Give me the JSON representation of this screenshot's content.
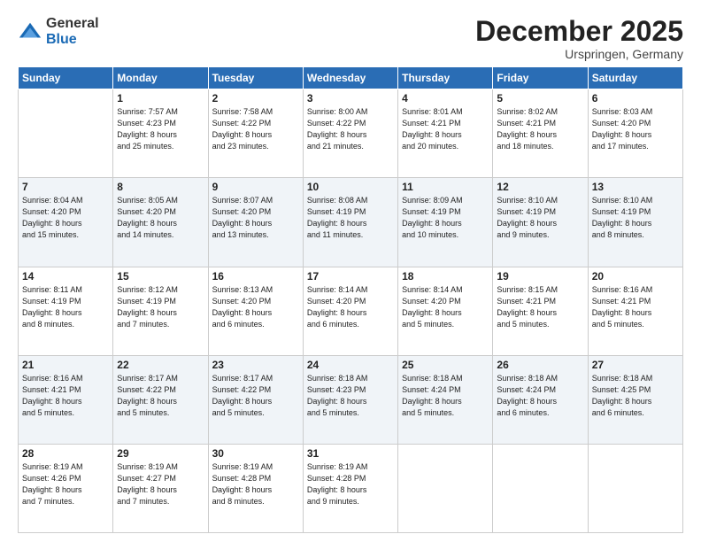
{
  "logo": {
    "general": "General",
    "blue": "Blue"
  },
  "header": {
    "month": "December 2025",
    "location": "Urspringen, Germany"
  },
  "weekdays": [
    "Sunday",
    "Monday",
    "Tuesday",
    "Wednesday",
    "Thursday",
    "Friday",
    "Saturday"
  ],
  "weeks": [
    [
      {
        "num": "",
        "info": ""
      },
      {
        "num": "1",
        "info": "Sunrise: 7:57 AM\nSunset: 4:23 PM\nDaylight: 8 hours\nand 25 minutes."
      },
      {
        "num": "2",
        "info": "Sunrise: 7:58 AM\nSunset: 4:22 PM\nDaylight: 8 hours\nand 23 minutes."
      },
      {
        "num": "3",
        "info": "Sunrise: 8:00 AM\nSunset: 4:22 PM\nDaylight: 8 hours\nand 21 minutes."
      },
      {
        "num": "4",
        "info": "Sunrise: 8:01 AM\nSunset: 4:21 PM\nDaylight: 8 hours\nand 20 minutes."
      },
      {
        "num": "5",
        "info": "Sunrise: 8:02 AM\nSunset: 4:21 PM\nDaylight: 8 hours\nand 18 minutes."
      },
      {
        "num": "6",
        "info": "Sunrise: 8:03 AM\nSunset: 4:20 PM\nDaylight: 8 hours\nand 17 minutes."
      }
    ],
    [
      {
        "num": "7",
        "info": "Sunrise: 8:04 AM\nSunset: 4:20 PM\nDaylight: 8 hours\nand 15 minutes."
      },
      {
        "num": "8",
        "info": "Sunrise: 8:05 AM\nSunset: 4:20 PM\nDaylight: 8 hours\nand 14 minutes."
      },
      {
        "num": "9",
        "info": "Sunrise: 8:07 AM\nSunset: 4:20 PM\nDaylight: 8 hours\nand 13 minutes."
      },
      {
        "num": "10",
        "info": "Sunrise: 8:08 AM\nSunset: 4:19 PM\nDaylight: 8 hours\nand 11 minutes."
      },
      {
        "num": "11",
        "info": "Sunrise: 8:09 AM\nSunset: 4:19 PM\nDaylight: 8 hours\nand 10 minutes."
      },
      {
        "num": "12",
        "info": "Sunrise: 8:10 AM\nSunset: 4:19 PM\nDaylight: 8 hours\nand 9 minutes."
      },
      {
        "num": "13",
        "info": "Sunrise: 8:10 AM\nSunset: 4:19 PM\nDaylight: 8 hours\nand 8 minutes."
      }
    ],
    [
      {
        "num": "14",
        "info": "Sunrise: 8:11 AM\nSunset: 4:19 PM\nDaylight: 8 hours\nand 8 minutes."
      },
      {
        "num": "15",
        "info": "Sunrise: 8:12 AM\nSunset: 4:19 PM\nDaylight: 8 hours\nand 7 minutes."
      },
      {
        "num": "16",
        "info": "Sunrise: 8:13 AM\nSunset: 4:20 PM\nDaylight: 8 hours\nand 6 minutes."
      },
      {
        "num": "17",
        "info": "Sunrise: 8:14 AM\nSunset: 4:20 PM\nDaylight: 8 hours\nand 6 minutes."
      },
      {
        "num": "18",
        "info": "Sunrise: 8:14 AM\nSunset: 4:20 PM\nDaylight: 8 hours\nand 5 minutes."
      },
      {
        "num": "19",
        "info": "Sunrise: 8:15 AM\nSunset: 4:21 PM\nDaylight: 8 hours\nand 5 minutes."
      },
      {
        "num": "20",
        "info": "Sunrise: 8:16 AM\nSunset: 4:21 PM\nDaylight: 8 hours\nand 5 minutes."
      }
    ],
    [
      {
        "num": "21",
        "info": "Sunrise: 8:16 AM\nSunset: 4:21 PM\nDaylight: 8 hours\nand 5 minutes."
      },
      {
        "num": "22",
        "info": "Sunrise: 8:17 AM\nSunset: 4:22 PM\nDaylight: 8 hours\nand 5 minutes."
      },
      {
        "num": "23",
        "info": "Sunrise: 8:17 AM\nSunset: 4:22 PM\nDaylight: 8 hours\nand 5 minutes."
      },
      {
        "num": "24",
        "info": "Sunrise: 8:18 AM\nSunset: 4:23 PM\nDaylight: 8 hours\nand 5 minutes."
      },
      {
        "num": "25",
        "info": "Sunrise: 8:18 AM\nSunset: 4:24 PM\nDaylight: 8 hours\nand 5 minutes."
      },
      {
        "num": "26",
        "info": "Sunrise: 8:18 AM\nSunset: 4:24 PM\nDaylight: 8 hours\nand 6 minutes."
      },
      {
        "num": "27",
        "info": "Sunrise: 8:18 AM\nSunset: 4:25 PM\nDaylight: 8 hours\nand 6 minutes."
      }
    ],
    [
      {
        "num": "28",
        "info": "Sunrise: 8:19 AM\nSunset: 4:26 PM\nDaylight: 8 hours\nand 7 minutes."
      },
      {
        "num": "29",
        "info": "Sunrise: 8:19 AM\nSunset: 4:27 PM\nDaylight: 8 hours\nand 7 minutes."
      },
      {
        "num": "30",
        "info": "Sunrise: 8:19 AM\nSunset: 4:28 PM\nDaylight: 8 hours\nand 8 minutes."
      },
      {
        "num": "31",
        "info": "Sunrise: 8:19 AM\nSunset: 4:28 PM\nDaylight: 8 hours\nand 9 minutes."
      },
      {
        "num": "",
        "info": ""
      },
      {
        "num": "",
        "info": ""
      },
      {
        "num": "",
        "info": ""
      }
    ]
  ]
}
